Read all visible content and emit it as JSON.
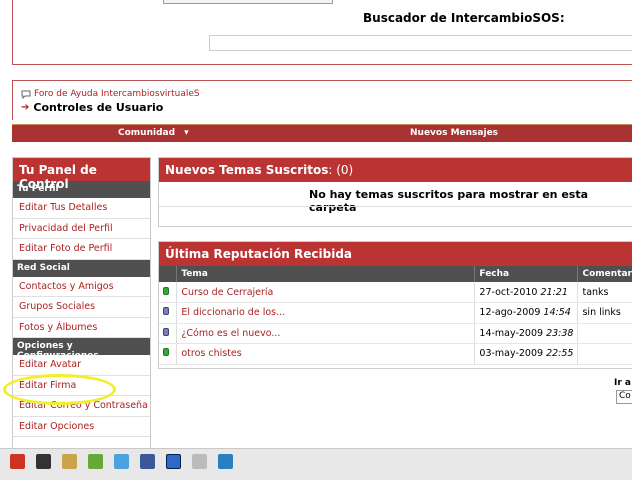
{
  "header": {
    "search_title": "Buscador de IntercambioSOS:",
    "search_value": ""
  },
  "breadcrumb": {
    "forum_link": "Foro de Ayuda IntercambiosvirtualeS",
    "page_title": "Controles de Usuario"
  },
  "navbar": {
    "comunidad": "Comunidad",
    "comunidad_arrow": "▾",
    "nuevos_mensajes": "Nuevos Mensajes"
  },
  "sidebar": {
    "title": "Tu Panel de Control",
    "sections": [
      {
        "label": "Tu Perfil",
        "items": [
          "Editar Tus Detalles",
          "Privacidad del Perfil",
          "Editar Foto de Perfil"
        ]
      },
      {
        "label": "Red Social",
        "items": [
          "Contactos y Amigos",
          "Grupos Sociales",
          "Fotos y Álbumes"
        ]
      },
      {
        "label": "Opciones y Configuraciones",
        "items": [
          "Editar Avatar",
          "Editar Firma",
          "Editar Correo y Contraseña",
          "Editar Opciones"
        ]
      }
    ]
  },
  "subscribed": {
    "title": "Nuevos Temas Suscritos",
    "count": ": (0)",
    "empty_message": "No hay temas suscritos para mostrar en esta carpeta"
  },
  "reputation": {
    "title": "Última Reputación Recibida",
    "columns": [
      "Tema",
      "Fecha",
      "Comentar"
    ],
    "rows": [
      {
        "status": "green",
        "tema": "Curso de Cerrajería",
        "date": "27-oct-2010",
        "time": "21:21",
        "comment": "tanks"
      },
      {
        "status": "blue",
        "tema": "El diccionario de los...",
        "date": "12-ago-2009",
        "time": "14:54",
        "comment": "sin links"
      },
      {
        "status": "blue",
        "tema": "¿Cómo es el nuevo...",
        "date": "14-may-2009",
        "time": "23:38",
        "comment": ""
      },
      {
        "status": "green",
        "tema": "otros chistes",
        "date": "03-may-2009",
        "time": "22:55",
        "comment": ""
      }
    ]
  },
  "jump": {
    "label": "Ir a",
    "value": "Co"
  },
  "colors": {
    "brand_red": "#b33333",
    "section_gray": "#505050",
    "link_red": "#aa2222",
    "highlight_yellow": "#f1ee2a"
  },
  "taskbar": {
    "icons": [
      "app-red-icon",
      "app-dark-icon",
      "folder-icon",
      "app-green-icon",
      "twitter-icon",
      "facebook-icon",
      "app-blue-icon",
      "app-gray-icon",
      "chat-icon"
    ]
  }
}
